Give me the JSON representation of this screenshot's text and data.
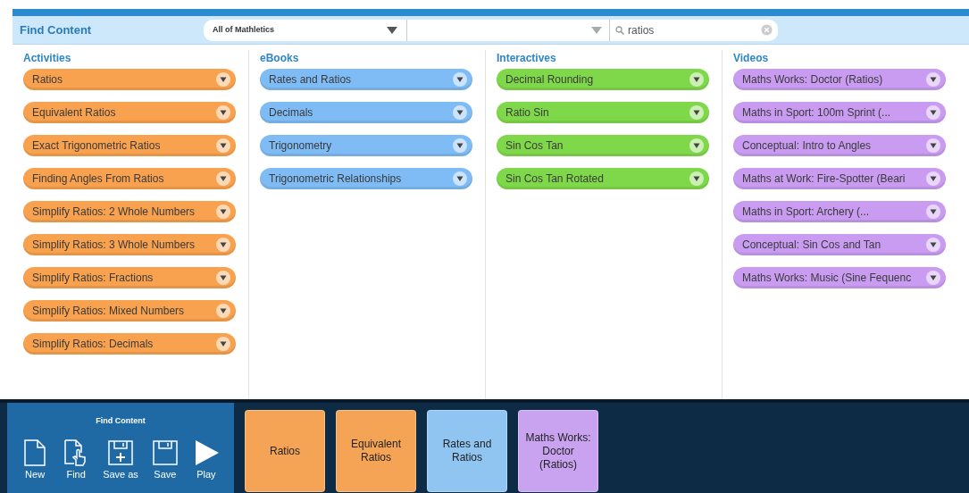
{
  "header": {
    "title": "Find Content",
    "scope": {
      "value": "All of Mathletics"
    },
    "search": {
      "value": "ratios"
    }
  },
  "columns": [
    {
      "title": "Activities",
      "color": "#f8a24f",
      "items": [
        "Ratios",
        "Equivalent Ratios",
        "Exact Trigonometric Ratios",
        "Finding Angles From Ratios",
        "Simplify Ratios: 2 Whole Numbers",
        "Simplify Ratios: 3 Whole Numbers",
        "Simplify Ratios: Fractions",
        "Simplify Ratios: Mixed Numbers",
        "Simplify Ratios: Decimals"
      ]
    },
    {
      "title": "eBooks",
      "color": "#7fbcf5",
      "items": [
        "Rates and Ratios",
        "Decimals",
        "Trigonometry",
        "Trigonometric Relationships"
      ]
    },
    {
      "title": "Interactives",
      "color": "#7fd84a",
      "items": [
        "Decimal Rounding",
        "Ratio Sin",
        "Sin Cos Tan",
        "Sin Cos Tan Rotated"
      ]
    },
    {
      "title": "Videos",
      "color": "#c99cf2",
      "items": [
        "Maths Works: Doctor (Ratios)",
        "Maths in Sport: 100m Sprint (...",
        "Conceptual: Intro to Angles",
        "Maths at Work: Fire-Spotter (Beari",
        "Maths in Sport: Archery (...",
        "Conceptual: Sin Cos and Tan",
        "Maths Works: Music (Sine Fequenc"
      ]
    }
  ],
  "toolbar": {
    "title": "Find Content",
    "buttons": [
      {
        "kind": "new",
        "label": "New"
      },
      {
        "kind": "find",
        "label": "Find"
      },
      {
        "kind": "saveas",
        "label": "Save as"
      },
      {
        "kind": "save",
        "label": "Save"
      },
      {
        "kind": "play",
        "label": "Play"
      }
    ]
  },
  "tiles": [
    {
      "label": "Ratios",
      "color": "#f5a455"
    },
    {
      "label": "Equivalent Ratios",
      "color": "#f5a455"
    },
    {
      "label": "Rates and Ratios",
      "color": "#90c5f2"
    },
    {
      "label": "Maths Works: Doctor (Ratios)",
      "color": "#c9a3ef"
    }
  ]
}
